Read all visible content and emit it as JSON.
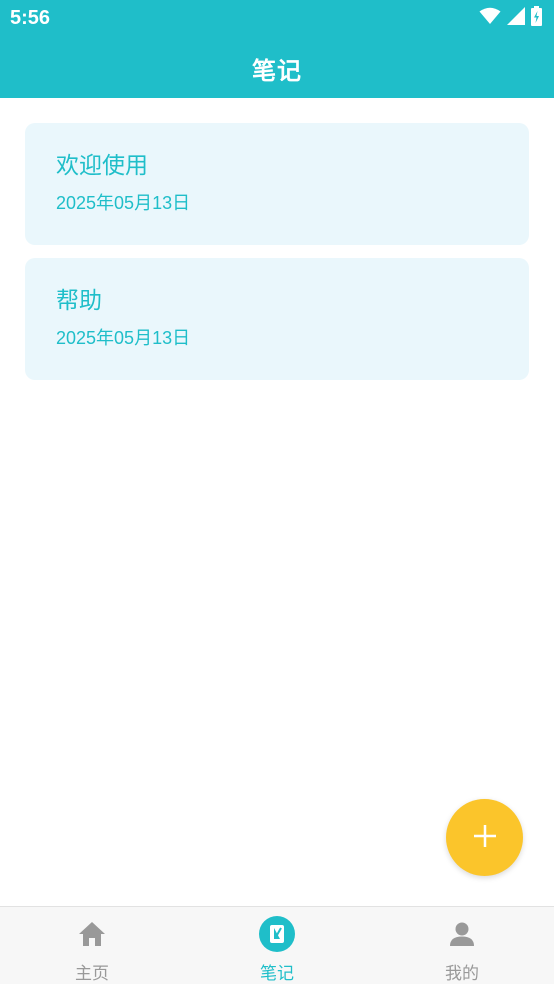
{
  "status_bar": {
    "time": "5:56"
  },
  "header": {
    "title": "笔记"
  },
  "notes": [
    {
      "title": "欢迎使用",
      "date": "2025年05月13日"
    },
    {
      "title": "帮助",
      "date": "2025年05月13日"
    }
  ],
  "fab": {
    "icon": "plus-icon"
  },
  "bottom_nav": {
    "items": [
      {
        "label": "主页",
        "icon": "home-icon",
        "active": false
      },
      {
        "label": "笔记",
        "icon": "note-icon",
        "active": true
      },
      {
        "label": "我的",
        "icon": "person-icon",
        "active": false
      }
    ]
  },
  "colors": {
    "primary": "#1fbec9",
    "card_background": "#eaf7fc",
    "fab": "#fbc52b",
    "inactive_nav": "#999999"
  }
}
